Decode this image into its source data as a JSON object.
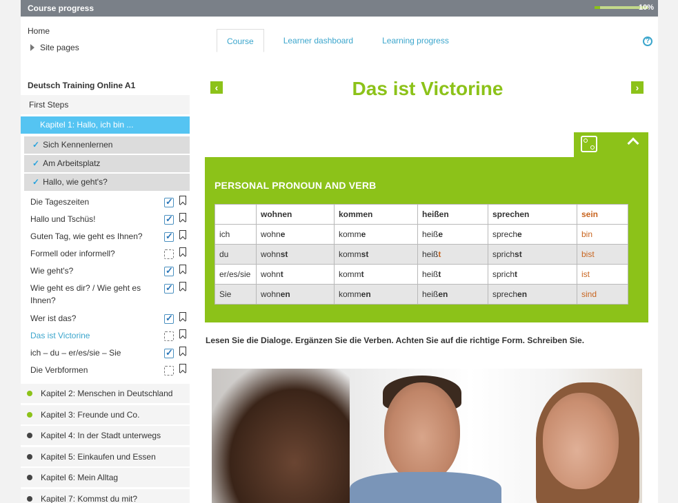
{
  "progress": {
    "label": "Course progress",
    "value": 0.1,
    "percent_text": "10%",
    "fill_color": "#8cc219"
  },
  "nav": {
    "home": "Home",
    "site_pages": "Site pages"
  },
  "course": {
    "title": "Deutsch Training Online A1",
    "section": "First Steps",
    "active_chapter": "Kapitel 1: Hallo, ich bin ...",
    "subsections": [
      "Sich Kennenlernen",
      "Am Arbeitsplatz",
      "Hallo, wie geht's?"
    ],
    "lessons": [
      {
        "title": "Die Tageszeiten",
        "done": true
      },
      {
        "title": "Hallo und Tschüs!",
        "done": true
      },
      {
        "title": "Guten Tag, wie geht es Ihnen?",
        "done": true
      },
      {
        "title": "Formell oder informell?",
        "done": false
      },
      {
        "title": "Wie geht's?",
        "done": true
      },
      {
        "title": "Wie geht es dir? / Wie geht es Ihnen?",
        "done": true
      },
      {
        "title": "Wer ist das?",
        "done": true
      },
      {
        "title": "Das ist Victorine",
        "done": false
      },
      {
        "title": "ich – du – er/es/sie – Sie",
        "done": true
      },
      {
        "title": "Die Verbformen",
        "done": false
      }
    ],
    "chapters": [
      {
        "title": "Kapitel 2: Menschen in Deutschland",
        "color": "#8cc219"
      },
      {
        "title": "Kapitel 3: Freunde und Co.",
        "color": "#8cc219"
      },
      {
        "title": "Kapitel 4: In der Stadt unterwegs",
        "color": "#444444"
      },
      {
        "title": "Kapitel 5: Einkaufen und Essen",
        "color": "#444444"
      },
      {
        "title": "Kapitel 6: Mein Alltag",
        "color": "#444444"
      },
      {
        "title": "Kapitel 7: Kommst du mit?",
        "color": "#444444"
      }
    ]
  },
  "tabs": [
    "Course",
    "Learner dashboard",
    "Learning progress"
  ],
  "lesson": {
    "title": "Das ist Victorine",
    "prev_icon": "chevron-left-icon",
    "next_icon": "chevron-right-icon",
    "box_heading": "PERSONAL PRONOUN AND VERB",
    "instruction": "Lesen Sie die Dialoge. Ergänzen Sie die Verben. Achten Sie auf die richtige Form. Schreiben Sie.",
    "table": {
      "headers": [
        "",
        "wohnen",
        "kommen",
        "heißen",
        "sprechen",
        "sein"
      ],
      "rows": [
        [
          [
            "ich"
          ],
          [
            "wohn",
            "e"
          ],
          [
            "komm",
            "e"
          ],
          [
            "heiß",
            "e"
          ],
          [
            "sprech",
            "e"
          ],
          [
            "bin"
          ]
        ],
        [
          [
            "du"
          ],
          [
            "wohn",
            "st"
          ],
          [
            "komm",
            "st"
          ],
          [
            "heiß",
            "t"
          ],
          [
            "sprich",
            "st"
          ],
          [
            "bist"
          ]
        ],
        [
          [
            "er/es/sie"
          ],
          [
            "wohn",
            "t"
          ],
          [
            "komm",
            "t"
          ],
          [
            "heiß",
            "t"
          ],
          [
            "sprich",
            "t"
          ],
          [
            "ist"
          ]
        ],
        [
          [
            "Sie"
          ],
          [
            "wohn",
            "en"
          ],
          [
            "komm",
            "en"
          ],
          [
            "heiß",
            "en"
          ],
          [
            "sprech",
            "en"
          ],
          [
            "sind"
          ]
        ]
      ]
    }
  },
  "colors": {
    "accent": "#8cc219",
    "link": "#3aa5cc",
    "active_blue": "#55c4f2",
    "sein": "#c8641e"
  }
}
